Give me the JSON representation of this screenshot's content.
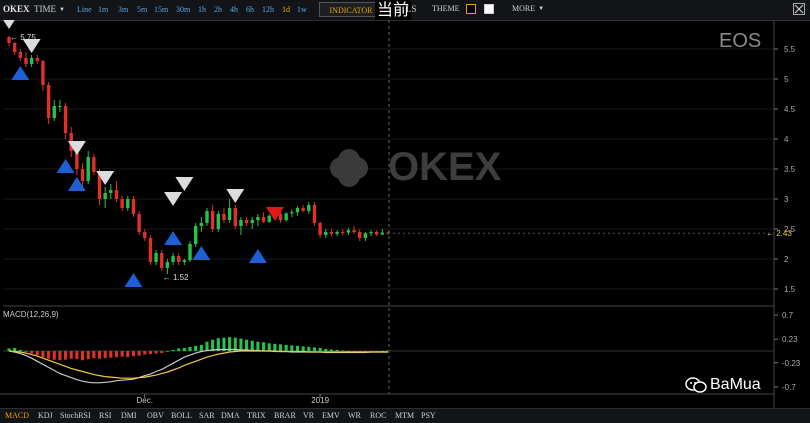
{
  "topbar": {
    "symbol": "OKEX",
    "time_label": "TIME",
    "intervals": [
      "Line",
      "1m",
      "3m",
      "5m",
      "15m",
      "30m",
      "1h",
      "2h",
      "4h",
      "6h",
      "12h",
      "1d",
      "1w"
    ],
    "active_interval": "1d",
    "indicator_label": "INDICATOR",
    "overlay_text": "当前",
    "ls_label": "LS",
    "theme_label": "THEME",
    "more_label": "MORE"
  },
  "bottom_tabs": [
    "MACD",
    "KDJ",
    "StochRSI",
    "RSI",
    "DMI",
    "OBV",
    "BOLL",
    "SAR",
    "DMA",
    "TRIX",
    "BRAR",
    "VR",
    "EMV",
    "WR",
    "ROC",
    "MTM",
    "PSY"
  ],
  "active_tab": "MACD",
  "watermark": "BaMua",
  "colors": {
    "up": "#26c24f",
    "down": "#e0302a",
    "ema_fast": "#f2c744",
    "ema_slow": "#c8c8c8",
    "last_price": "#e8c840",
    "signal_sell": "#dcdcdc",
    "signal_buy": "#1f5fd6",
    "signal_sell_red": "#e01818"
  },
  "chart_data": {
    "type": "candlestick",
    "symbol_label": "EOS",
    "logo_text": "OKEX",
    "y_ticks": [
      "5.5",
      "5",
      "4.5",
      "4",
      "3.5",
      "3",
      "2.5",
      "2",
      "1.5"
    ],
    "ylim": [
      1.25,
      5.9
    ],
    "x_labels": [
      {
        "label": "Dec.",
        "index": 24
      },
      {
        "label": "2019",
        "index": 55
      }
    ],
    "high_label": "5.75",
    "low_label": "1.52",
    "last_price": "2.43",
    "candles": [
      [
        5.7,
        5.72,
        5.55,
        5.6
      ],
      [
        5.6,
        5.62,
        5.4,
        5.45
      ],
      [
        5.45,
        5.5,
        5.3,
        5.35
      ],
      [
        5.35,
        5.45,
        5.2,
        5.25
      ],
      [
        5.25,
        5.4,
        5.2,
        5.35
      ],
      [
        5.35,
        5.4,
        5.25,
        5.3
      ],
      [
        5.3,
        5.32,
        4.8,
        4.9
      ],
      [
        4.9,
        4.95,
        4.25,
        4.35
      ],
      [
        4.35,
        4.65,
        4.3,
        4.55
      ],
      [
        4.55,
        4.65,
        4.45,
        4.55
      ],
      [
        4.55,
        4.6,
        4.0,
        4.1
      ],
      [
        4.1,
        4.2,
        3.7,
        3.8
      ],
      [
        3.8,
        3.9,
        3.4,
        3.5
      ],
      [
        3.5,
        3.6,
        3.2,
        3.3
      ],
      [
        3.3,
        3.8,
        3.25,
        3.7
      ],
      [
        3.7,
        3.75,
        3.4,
        3.45
      ],
      [
        3.45,
        3.5,
        2.9,
        3.0
      ],
      [
        3.0,
        3.2,
        2.85,
        3.1
      ],
      [
        3.1,
        3.25,
        3.0,
        3.15
      ],
      [
        3.15,
        3.3,
        2.95,
        3.0
      ],
      [
        3.0,
        3.05,
        2.8,
        2.85
      ],
      [
        2.85,
        3.05,
        2.8,
        3.0
      ],
      [
        3.0,
        3.05,
        2.7,
        2.75
      ],
      [
        2.75,
        2.8,
        2.4,
        2.45
      ],
      [
        2.45,
        2.5,
        2.3,
        2.35
      ],
      [
        2.35,
        2.4,
        1.9,
        1.95
      ],
      [
        1.95,
        2.15,
        1.9,
        2.1
      ],
      [
        2.1,
        2.15,
        1.8,
        1.85
      ],
      [
        1.85,
        2.0,
        1.75,
        1.95
      ],
      [
        1.95,
        2.1,
        1.9,
        2.05
      ],
      [
        2.05,
        2.1,
        1.9,
        1.95
      ],
      [
        1.95,
        2.0,
        1.9,
        1.98
      ],
      [
        1.98,
        2.3,
        1.95,
        2.25
      ],
      [
        2.25,
        2.6,
        2.2,
        2.55
      ],
      [
        2.55,
        2.7,
        2.45,
        2.6
      ],
      [
        2.6,
        2.85,
        2.55,
        2.8
      ],
      [
        2.8,
        2.9,
        2.45,
        2.5
      ],
      [
        2.5,
        2.8,
        2.45,
        2.75
      ],
      [
        2.75,
        2.85,
        2.6,
        2.65
      ],
      [
        2.65,
        3.0,
        2.6,
        2.85
      ],
      [
        2.85,
        2.9,
        2.5,
        2.55
      ],
      [
        2.55,
        2.7,
        2.4,
        2.65
      ],
      [
        2.65,
        2.7,
        2.55,
        2.6
      ],
      [
        2.6,
        2.7,
        2.5,
        2.65
      ],
      [
        2.65,
        2.75,
        2.55,
        2.7
      ],
      [
        2.7,
        2.78,
        2.6,
        2.62
      ],
      [
        2.62,
        2.75,
        2.6,
        2.72
      ],
      [
        2.72,
        2.8,
        2.65,
        2.75
      ],
      [
        2.75,
        2.8,
        2.6,
        2.65
      ],
      [
        2.65,
        2.78,
        2.62,
        2.76
      ],
      [
        2.76,
        2.82,
        2.7,
        2.78
      ],
      [
        2.78,
        2.88,
        2.72,
        2.85
      ],
      [
        2.85,
        2.9,
        2.78,
        2.8
      ],
      [
        2.8,
        2.95,
        2.75,
        2.9
      ],
      [
        2.9,
        2.95,
        2.55,
        2.6
      ],
      [
        2.6,
        2.62,
        2.35,
        2.4
      ],
      [
        2.4,
        2.5,
        2.35,
        2.45
      ],
      [
        2.45,
        2.5,
        2.38,
        2.42
      ],
      [
        2.42,
        2.48,
        2.38,
        2.45
      ],
      [
        2.45,
        2.5,
        2.4,
        2.44
      ],
      [
        2.44,
        2.52,
        2.4,
        2.48
      ],
      [
        2.48,
        2.55,
        2.42,
        2.45
      ],
      [
        2.45,
        2.5,
        2.3,
        2.35
      ],
      [
        2.35,
        2.45,
        2.3,
        2.43
      ],
      [
        2.43,
        2.48,
        2.38,
        2.45
      ],
      [
        2.45,
        2.48,
        2.38,
        2.41
      ],
      [
        2.41,
        2.5,
        2.4,
        2.44
      ],
      [
        2.44,
        2.46,
        2.4,
        2.43
      ]
    ],
    "signals": [
      {
        "index": 0,
        "type": "sell",
        "color": "white",
        "price": 5.95
      },
      {
        "index": 2,
        "type": "buy",
        "color": "blue",
        "price": 5.1
      },
      {
        "index": 4,
        "type": "sell",
        "color": "white",
        "price": 5.55
      },
      {
        "index": 10,
        "type": "buy",
        "color": "blue",
        "price": 3.55
      },
      {
        "index": 12,
        "type": "sell",
        "color": "white",
        "price": 3.85
      },
      {
        "index": 12,
        "type": "buy",
        "color": "blue",
        "price": 3.25
      },
      {
        "index": 17,
        "type": "sell",
        "color": "white",
        "price": 3.35
      },
      {
        "index": 22,
        "type": "buy",
        "color": "blue",
        "price": 1.65
      },
      {
        "index": 29,
        "type": "sell",
        "color": "white",
        "price": 3.0
      },
      {
        "index": 29,
        "type": "buy",
        "color": "blue",
        "price": 2.35
      },
      {
        "index": 31,
        "type": "sell",
        "color": "white",
        "price": 3.25
      },
      {
        "index": 34,
        "type": "buy",
        "color": "blue",
        "price": 2.1
      },
      {
        "index": 40,
        "type": "sell",
        "color": "white",
        "price": 3.05
      },
      {
        "index": 44,
        "type": "buy",
        "color": "blue",
        "price": 2.05
      },
      {
        "index": 47,
        "type": "sell",
        "color": "red",
        "price": 2.75
      }
    ],
    "macd": {
      "label": "MACD(12,26,9)",
      "y_ticks": [
        "0.7",
        "0.23",
        "-0.23",
        "-0.7"
      ],
      "ylim": [
        -0.8,
        0.8
      ],
      "histogram": [
        0.05,
        0.06,
        0.02,
        -0.02,
        -0.05,
        -0.08,
        -0.12,
        -0.15,
        -0.17,
        -0.18,
        -0.17,
        -0.15,
        -0.16,
        -0.18,
        -0.16,
        -0.14,
        -0.15,
        -0.14,
        -0.13,
        -0.12,
        -0.11,
        -0.12,
        -0.1,
        -0.09,
        -0.07,
        -0.06,
        -0.05,
        -0.04,
        -0.02,
        0.02,
        0.05,
        0.06,
        0.08,
        0.1,
        0.12,
        0.18,
        0.22,
        0.25,
        0.26,
        0.27,
        0.26,
        0.24,
        0.22,
        0.2,
        0.18,
        0.17,
        0.15,
        0.14,
        0.13,
        0.12,
        0.11,
        0.1,
        0.09,
        0.08,
        0.07,
        0.06,
        0.04,
        0.03,
        0.02,
        0.01,
        0.0,
        -0.01,
        -0.02,
        -0.02,
        -0.01,
        -0.01,
        0.0,
        0.01
      ],
      "dif": [
        0.0,
        -0.02,
        -0.05,
        -0.09,
        -0.14,
        -0.2,
        -0.26,
        -0.32,
        -0.38,
        -0.44,
        -0.48,
        -0.52,
        -0.56,
        -0.59,
        -0.61,
        -0.62,
        -0.62,
        -0.61,
        -0.6,
        -0.58,
        -0.57,
        -0.56,
        -0.55,
        -0.52,
        -0.48,
        -0.45,
        -0.4,
        -0.36,
        -0.3,
        -0.24,
        -0.18,
        -0.12,
        -0.08,
        -0.04,
        -0.01,
        0.01,
        0.02,
        0.03,
        0.03,
        0.03,
        0.03,
        0.02,
        0.02,
        0.01,
        0.01,
        0.0,
        0.0,
        -0.01,
        -0.01,
        -0.01,
        -0.02,
        -0.02,
        -0.02,
        -0.02,
        -0.02,
        -0.02,
        -0.03,
        -0.03,
        -0.03,
        -0.03,
        -0.03,
        -0.03,
        -0.03,
        -0.03,
        -0.02,
        -0.02,
        -0.02,
        -0.02
      ],
      "dea": [
        0.0,
        -0.01,
        -0.02,
        -0.04,
        -0.07,
        -0.1,
        -0.14,
        -0.18,
        -0.22,
        -0.26,
        -0.3,
        -0.34,
        -0.37,
        -0.4,
        -0.43,
        -0.46,
        -0.48,
        -0.5,
        -0.51,
        -0.52,
        -0.53,
        -0.53,
        -0.53,
        -0.52,
        -0.51,
        -0.49,
        -0.47,
        -0.44,
        -0.41,
        -0.37,
        -0.33,
        -0.28,
        -0.24,
        -0.2,
        -0.16,
        -0.12,
        -0.09,
        -0.06,
        -0.04,
        -0.02,
        -0.01,
        0.0,
        0.0,
        0.0,
        0.0,
        0.0,
        0.0,
        0.0,
        -0.01,
        -0.01,
        -0.01,
        -0.01,
        -0.01,
        -0.02,
        -0.02,
        -0.02,
        -0.02,
        -0.02,
        -0.02,
        -0.02,
        -0.02,
        -0.02,
        -0.02,
        -0.02,
        -0.02,
        -0.02,
        -0.02,
        -0.02
      ]
    }
  }
}
